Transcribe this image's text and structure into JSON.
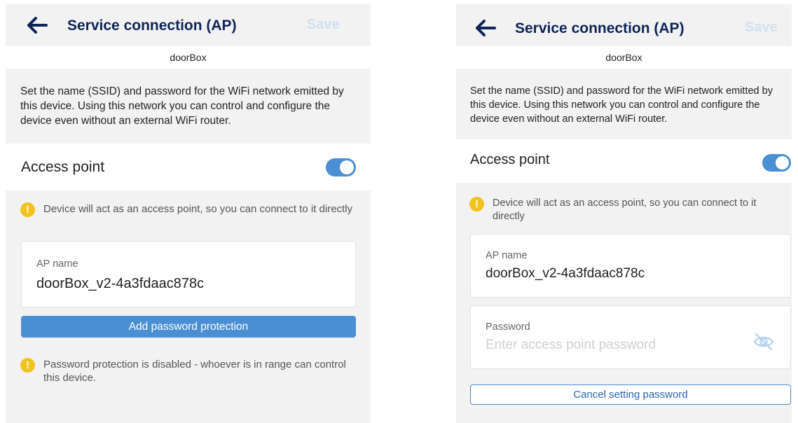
{
  "header": {
    "title": "Service connection (AP)",
    "save_label": "Save"
  },
  "device_name": "doorBox",
  "description": "Set the name (SSID) and password for the WiFi network emitted by this device. Using this network you can control and configure the device even without an external WiFi router.",
  "access_point": {
    "label": "Access point",
    "enabled": true
  },
  "ap_notice": "Device will act as an access point, so you can connect to it directly",
  "ap_name_field": {
    "label": "AP name",
    "value": "doorBox_v2-4a3fdaac878c"
  },
  "left": {
    "add_password_label": "Add password protection",
    "password_warning": "Password protection is disabled - whoever is in range can control this device."
  },
  "right": {
    "password_field": {
      "label": "Password",
      "placeholder": "Enter access point password"
    },
    "cancel_password_label": "Cancel setting password"
  },
  "colors": {
    "accent": "#4a8fd4",
    "title": "#0d2457",
    "warning": "#f2c31f",
    "save_disabled": "#cfe0f1"
  },
  "icons": {
    "back": "arrow-left-icon",
    "warning": "exclamation-circle-icon",
    "visibility": "eye-off-icon"
  }
}
